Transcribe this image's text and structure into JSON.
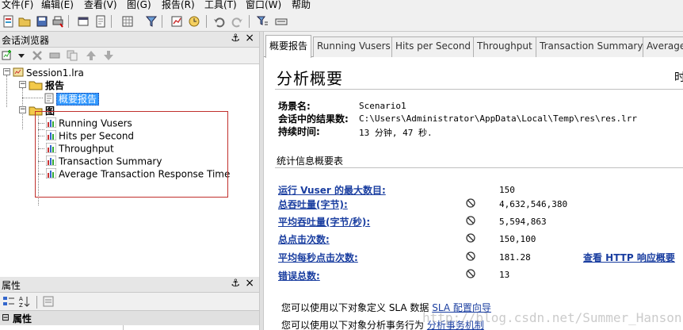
{
  "menu": [
    "文件(F)",
    "编辑(E)",
    "查看(V)",
    "图(G)",
    "报告(R)",
    "工具(T)",
    "窗口(W)",
    "帮助"
  ],
  "session_browser": {
    "title": "会话浏览器",
    "pin": "⚓",
    "close": "×",
    "session": "Session1.lra",
    "report_group": "报告",
    "report_item": "概要报告",
    "graph_group": "图",
    "graphs": [
      "Running Vusers",
      "Hits per Second",
      "Throughput",
      "Transaction Summary",
      "Average Transaction Response Time"
    ]
  },
  "properties": {
    "title": "属性",
    "section": "属性"
  },
  "tabs": [
    "概要报告",
    "Running Vusers",
    "Hits per Second",
    "Throughput",
    "Transaction Summary",
    "Average"
  ],
  "summary": {
    "heading": "分析概要",
    "right_cut": "时",
    "scenario_label": "场景名:",
    "scenario_value": "Scenario1",
    "results_label": "会话中的结果数:",
    "results_value": "C:\\Users\\Administrator\\AppData\\Local\\Temp\\res\\res.lrr",
    "duration_label": "持续时间:",
    "duration_value": "13 分钟, 47 秒.",
    "stats_heading": "统计信息概要表",
    "stats": [
      {
        "label": "运行 Vuser 的最大数目:",
        "value": "150",
        "icon": false
      },
      {
        "label": "总吞吐量(字节):",
        "value": "4,632,546,380",
        "icon": true
      },
      {
        "label": "平均吞吐量(字节/秒):",
        "value": "5,594,863",
        "icon": true
      },
      {
        "label": "总点击次数:",
        "value": "150,100",
        "icon": true
      },
      {
        "label": "平均每秒点击次数:",
        "value": "181.28",
        "icon": true
      },
      {
        "label": "错误总数:",
        "value": "13",
        "icon": true
      }
    ],
    "http_link": "查看 HTTP 响应概要",
    "sla_text": "您可以使用以下对象定义 SLA 数据",
    "sla_link": "SLA 配置向导",
    "analyze_text": "您可以使用以下对象分析事务行为",
    "analyze_link": "分析事务机制"
  },
  "watermark": "http://blog.csdn.net/Summer_Hanson",
  "colors": {
    "link": "#1a3ea0",
    "highlight": "#3399ff",
    "redbox": "#c0302c"
  }
}
